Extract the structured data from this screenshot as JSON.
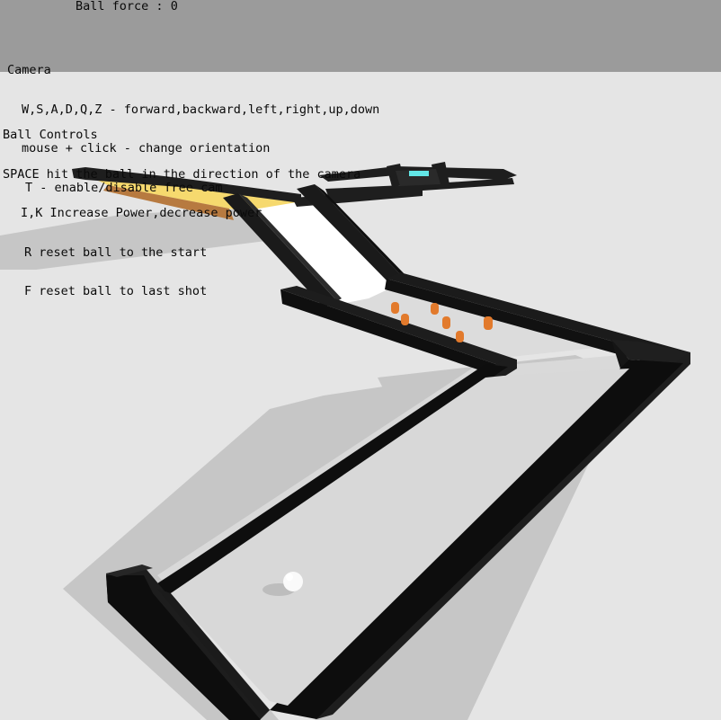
{
  "hud": {
    "ball_force_label": "Ball force",
    "ball_force_separator": ":",
    "ball_force_value": "0",
    "camera": {
      "heading": "Camera",
      "lines": [
        "W,S,A,D,Q,Z - forward,backward,left,right,up,down",
        "mouse + click - change orientation",
        "T - enable/disable free cam"
      ]
    },
    "ball_controls": {
      "heading": "Ball Controls",
      "lines": [
        "SPACE hit the ball in the direction of the camera",
        "I,K Increase Power,decrease power",
        "R reset ball to the start",
        "F reset ball to last shot"
      ]
    }
  },
  "scene": {
    "colors": {
      "background": "#e5e5e5",
      "hud_band": "#9b9b9b",
      "course_floor": "#d7d7d7",
      "wall": "#1c1c1c",
      "wall_side": "#0e0e0e",
      "shadow": "#c4c4c4",
      "ramp": "#ffffff",
      "boost_pad": "#f4d66a",
      "pins": "#e07a2a",
      "ball": "#fafafa"
    },
    "pin_count": 6
  }
}
